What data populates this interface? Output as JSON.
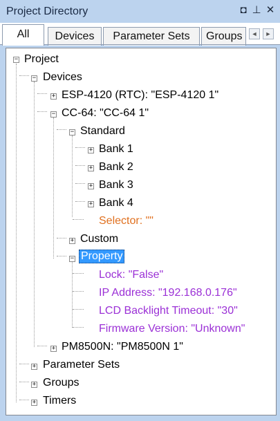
{
  "window": {
    "title": "Project Directory",
    "pin_glyph": "◘",
    "autohide_glyph": "⊥",
    "close_glyph": "✕"
  },
  "tabs": [
    {
      "label": "All",
      "active": true
    },
    {
      "label": "Devices",
      "active": false
    },
    {
      "label": "Parameter Sets",
      "active": false
    },
    {
      "label": "Groups",
      "active": false
    }
  ],
  "tab_scroll": {
    "left_glyph": "◄",
    "right_glyph": "►"
  },
  "colors": {
    "panel_bg": "#bcd3ee",
    "selected_bg": "#3399ff",
    "selector_text": "#e0701f",
    "property_text": "#9b30d6"
  },
  "tree": {
    "project": "Project",
    "devices": "Devices",
    "esp4120": "ESP-4120 (RTC): \"ESP-4120 1\"",
    "cc64": "CC-64: \"CC-64 1\"",
    "standard": "Standard",
    "bank1": "Bank 1",
    "bank2": "Bank 2",
    "bank3": "Bank 3",
    "bank4": "Bank 4",
    "selector": "Selector: \"\"",
    "custom": "Custom",
    "property": "Property",
    "lock": "Lock: \"False\"",
    "ip_address": "IP Address: \"192.168.0.176\"",
    "lcd_timeout": "LCD Backlight Timeout: \"30\"",
    "firmware": "Firmware Version: \"Unknown\"",
    "pm8500n": "PM8500N: \"PM8500N 1\"",
    "parameter_sets": "Parameter Sets",
    "groups": "Groups",
    "timers": "Timers"
  },
  "expander_glyphs": {
    "expanded": "−",
    "collapsed": "+"
  }
}
